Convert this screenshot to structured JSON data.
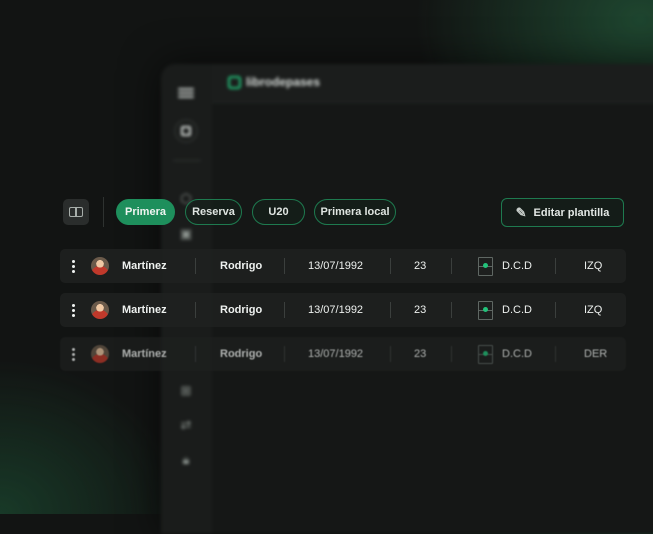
{
  "app": {
    "brand": "librodepases"
  },
  "filters": [
    {
      "label": "Primera",
      "active": true
    },
    {
      "label": "Reserva",
      "active": false
    },
    {
      "label": "U20",
      "active": false
    },
    {
      "label": "Primera local",
      "active": false
    }
  ],
  "edit_button": {
    "label": "Editar plantilla"
  },
  "players": [
    {
      "surname": "Martínez",
      "name": "Rodrigo",
      "birthdate": "13/07/1992",
      "number": "23",
      "position": "D.C.D",
      "foot": "IZQ"
    },
    {
      "surname": "Martínez",
      "name": "Rodrigo",
      "birthdate": "13/07/1992",
      "number": "23",
      "position": "D.C.D",
      "foot": "IZQ"
    },
    {
      "surname": "Martínez",
      "name": "Rodrigo",
      "birthdate": "13/07/1992",
      "number": "23",
      "position": "D.C.D",
      "foot": "DER"
    }
  ],
  "colors": {
    "accent": "#1e8f5c",
    "accent_border": "#1e7a4f",
    "background": "#121413"
  }
}
